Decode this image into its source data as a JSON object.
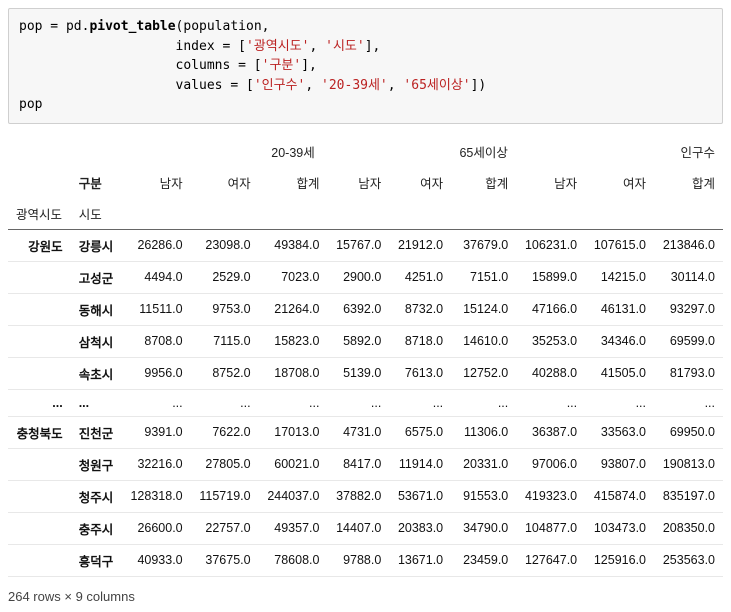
{
  "code": {
    "l1a": "pop = pd.",
    "l1b": "pivot_table",
    "l1c": "(population,",
    "l2a": "                    index = [",
    "l2s1": "'광역시도'",
    "l2c1": ", ",
    "l2s2": "'시도'",
    "l2b": "],",
    "l3a": "                    columns = [",
    "l3s1": "'구분'",
    "l3b": "],",
    "l4a": "                    values = [",
    "l4s1": "'인구수'",
    "l4c1": ", ",
    "l4s2": "'20-39세'",
    "l4c2": ", ",
    "l4s3": "'65세이상'",
    "l4b": "])",
    "l5": "pop"
  },
  "header": {
    "group1": "20-39세",
    "group2": "65세이상",
    "group3": "인구수",
    "colname": "구분",
    "sub1": "남자",
    "sub2": "여자",
    "sub3": "합계",
    "idx1": "광역시도",
    "idx2": "시도"
  },
  "rows": [
    {
      "lvl0": "강원도",
      "lvl1": "강릉시",
      "v": [
        "26286.0",
        "23098.0",
        "49384.0",
        "15767.0",
        "21912.0",
        "37679.0",
        "106231.0",
        "107615.0",
        "213846.0"
      ]
    },
    {
      "lvl0": "",
      "lvl1": "고성군",
      "v": [
        "4494.0",
        "2529.0",
        "7023.0",
        "2900.0",
        "4251.0",
        "7151.0",
        "15899.0",
        "14215.0",
        "30114.0"
      ]
    },
    {
      "lvl0": "",
      "lvl1": "동해시",
      "v": [
        "11511.0",
        "9753.0",
        "21264.0",
        "6392.0",
        "8732.0",
        "15124.0",
        "47166.0",
        "46131.0",
        "93297.0"
      ]
    },
    {
      "lvl0": "",
      "lvl1": "삼척시",
      "v": [
        "8708.0",
        "7115.0",
        "15823.0",
        "5892.0",
        "8718.0",
        "14610.0",
        "35253.0",
        "34346.0",
        "69599.0"
      ]
    },
    {
      "lvl0": "",
      "lvl1": "속초시",
      "v": [
        "9956.0",
        "8752.0",
        "18708.0",
        "5139.0",
        "7613.0",
        "12752.0",
        "40288.0",
        "41505.0",
        "81793.0"
      ]
    },
    {
      "lvl0": "...",
      "lvl1": "...",
      "v": [
        "...",
        "...",
        "...",
        "...",
        "...",
        "...",
        "...",
        "...",
        "..."
      ]
    },
    {
      "lvl0": "충청북도",
      "lvl1": "진천군",
      "v": [
        "9391.0",
        "7622.0",
        "17013.0",
        "4731.0",
        "6575.0",
        "11306.0",
        "36387.0",
        "33563.0",
        "69950.0"
      ]
    },
    {
      "lvl0": "",
      "lvl1": "청원구",
      "v": [
        "32216.0",
        "27805.0",
        "60021.0",
        "8417.0",
        "11914.0",
        "20331.0",
        "97006.0",
        "93807.0",
        "190813.0"
      ]
    },
    {
      "lvl0": "",
      "lvl1": "청주시",
      "v": [
        "128318.0",
        "115719.0",
        "244037.0",
        "37882.0",
        "53671.0",
        "91553.0",
        "419323.0",
        "415874.0",
        "835197.0"
      ]
    },
    {
      "lvl0": "",
      "lvl1": "충주시",
      "v": [
        "26600.0",
        "22757.0",
        "49357.0",
        "14407.0",
        "20383.0",
        "34790.0",
        "104877.0",
        "103473.0",
        "208350.0"
      ]
    },
    {
      "lvl0": "",
      "lvl1": "흥덕구",
      "v": [
        "40933.0",
        "37675.0",
        "78608.0",
        "9788.0",
        "13671.0",
        "23459.0",
        "127647.0",
        "125916.0",
        "253563.0"
      ]
    }
  ],
  "footer": "264 rows × 9 columns"
}
